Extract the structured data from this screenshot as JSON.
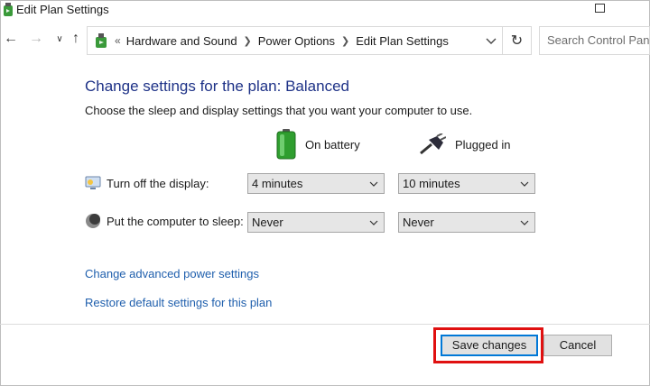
{
  "window": {
    "title": "Edit Plan Settings"
  },
  "nav": {
    "breadcrumb_separator": "«",
    "breadcrumbs": [
      "Hardware and Sound",
      "Power Options",
      "Edit Plan Settings"
    ],
    "search_placeholder": "Search Control Panel"
  },
  "main": {
    "heading": "Change settings for the plan: Balanced",
    "subtext": "Choose the sleep and display settings that you want your computer to use.",
    "columns": {
      "battery": "On battery",
      "plugged": "Plugged in"
    },
    "rows": {
      "display": {
        "label": "Turn off the display:",
        "battery_value": "4 minutes",
        "plugged_value": "10 minutes"
      },
      "sleep": {
        "label": "Put the computer to sleep:",
        "battery_value": "Never",
        "plugged_value": "Never"
      }
    },
    "links": {
      "advanced": "Change advanced power settings",
      "restore": "Restore default settings for this plan"
    }
  },
  "footer": {
    "save_label": "Save changes",
    "cancel_label": "Cancel"
  },
  "colors": {
    "heading": "#1e3287",
    "link": "#1f5fad",
    "highlight": "#e01010",
    "default_button_border": "#0078d7"
  },
  "icons": {
    "window": "power-options-icon",
    "battery": "battery-icon",
    "plugged": "plug-icon",
    "display": "display-icon",
    "sleep": "sleep-icon"
  }
}
